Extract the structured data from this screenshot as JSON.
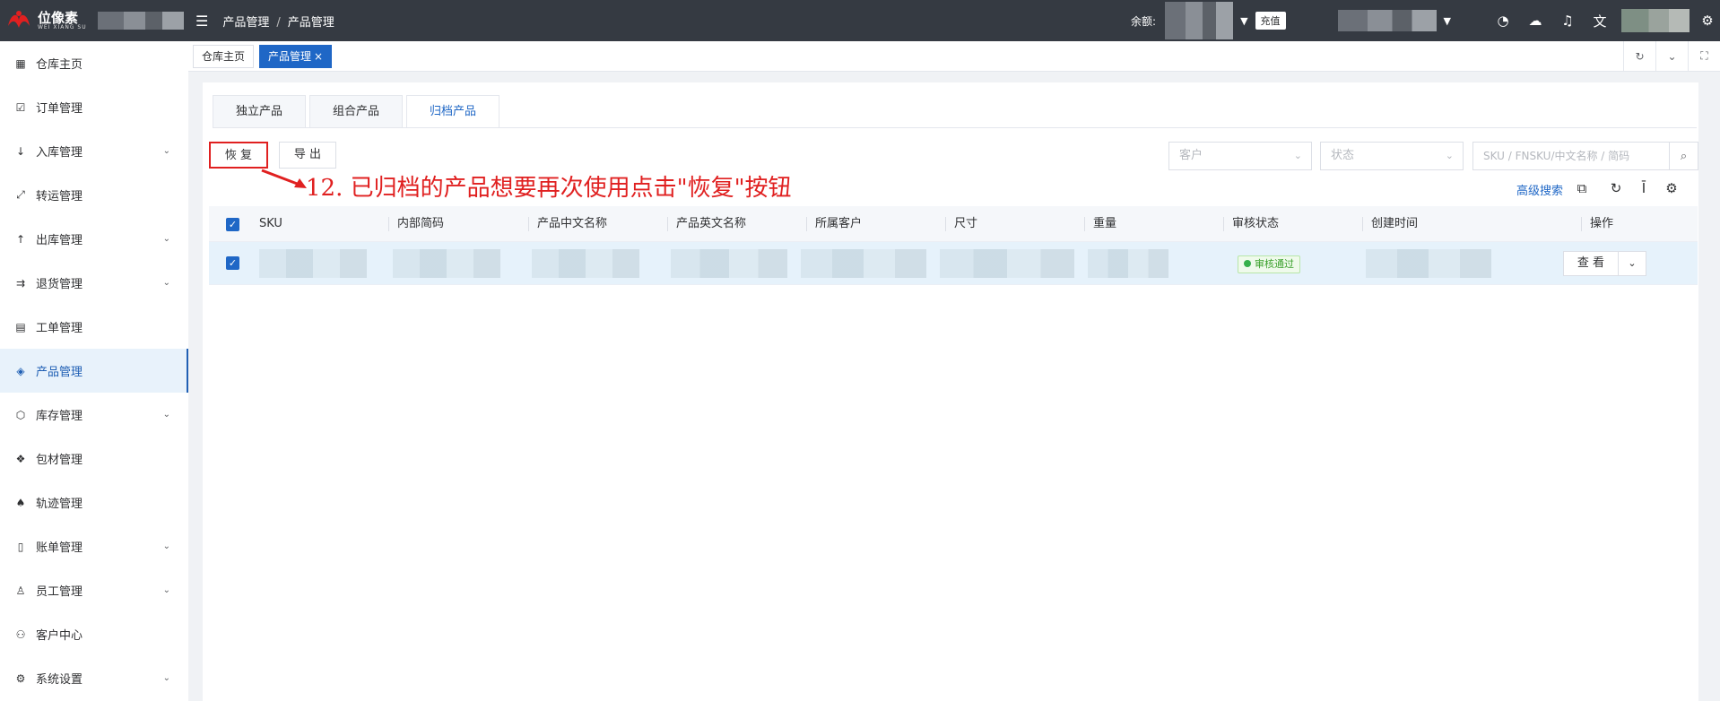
{
  "topbar": {
    "logo_text": "位像素",
    "logo_sub": "WEI XIANG SU",
    "breadcrumb": [
      "产品管理",
      "产品管理"
    ],
    "breadcrumb_sep": "/",
    "balance_label": "余额:",
    "recharge_label": "充值",
    "icons": [
      "clock-icon",
      "cloud-upload-icon",
      "bell-icon",
      "translate-icon",
      "settings-icon"
    ]
  },
  "sidebar": {
    "items": [
      {
        "label": "仓库主页",
        "icon": "grid-icon",
        "glyph": "▦",
        "expandable": false,
        "active": false
      },
      {
        "label": "订单管理",
        "icon": "calendar-icon",
        "glyph": "☑",
        "expandable": false,
        "active": false
      },
      {
        "label": "入库管理",
        "icon": "arrow-down-icon",
        "glyph": "↓",
        "expandable": true,
        "active": false
      },
      {
        "label": "转运管理",
        "icon": "transfer-icon",
        "glyph": "⤢",
        "expandable": false,
        "active": false
      },
      {
        "label": "出库管理",
        "icon": "arrow-up-icon",
        "glyph": "↑",
        "expandable": true,
        "active": false
      },
      {
        "label": "退货管理",
        "icon": "return-icon",
        "glyph": "⇉",
        "expandable": true,
        "active": false
      },
      {
        "label": "工单管理",
        "icon": "ticket-icon",
        "glyph": "▤",
        "expandable": false,
        "active": false
      },
      {
        "label": "产品管理",
        "icon": "product-icon",
        "glyph": "◈",
        "expandable": false,
        "active": true
      },
      {
        "label": "库存管理",
        "icon": "box-icon",
        "glyph": "⬡",
        "expandable": true,
        "active": false
      },
      {
        "label": "包材管理",
        "icon": "package-icon",
        "glyph": "❖",
        "expandable": false,
        "active": false
      },
      {
        "label": "轨迹管理",
        "icon": "track-icon",
        "glyph": "♠",
        "expandable": false,
        "active": false
      },
      {
        "label": "账单管理",
        "icon": "bill-icon",
        "glyph": "▯",
        "expandable": true,
        "active": false
      },
      {
        "label": "员工管理",
        "icon": "user-icon",
        "glyph": "♙",
        "expandable": true,
        "active": false
      },
      {
        "label": "客户中心",
        "icon": "customer-icon",
        "glyph": "⚇",
        "expandable": false,
        "active": false
      },
      {
        "label": "系统设置",
        "icon": "settings-icon",
        "glyph": "⚙",
        "expandable": true,
        "active": false
      }
    ]
  },
  "tagbar": {
    "tags": [
      {
        "label": "仓库主页",
        "active": false
      },
      {
        "label": "产品管理",
        "active": true
      }
    ]
  },
  "main": {
    "tabs": [
      {
        "label": "独立产品",
        "active": false
      },
      {
        "label": "组合产品",
        "active": false
      },
      {
        "label": "归档产品",
        "active": true
      }
    ],
    "restore_label": "恢 复",
    "export_label": "导 出",
    "annotation": "12. 已归档的产品想要再次使用点击\"恢复\"按钮",
    "filters": {
      "customer_placeholder": "客户",
      "status_placeholder": "状态",
      "search_placeholder": "SKU / FNSKU/中文名称 / 简码"
    },
    "advanced_search": "高级搜索",
    "table": {
      "columns": [
        "SKU",
        "内部简码",
        "产品中文名称",
        "产品英文名称",
        "所属客户",
        "尺寸",
        "重量",
        "审核状态",
        "创建时间",
        "操作"
      ],
      "rows": [
        {
          "status": "审核通过",
          "action": "查 看"
        }
      ]
    }
  },
  "colors": {
    "primary": "#1f67c6",
    "topbar": "#353a42",
    "annotation": "#e02020",
    "success": "#35b04a"
  }
}
